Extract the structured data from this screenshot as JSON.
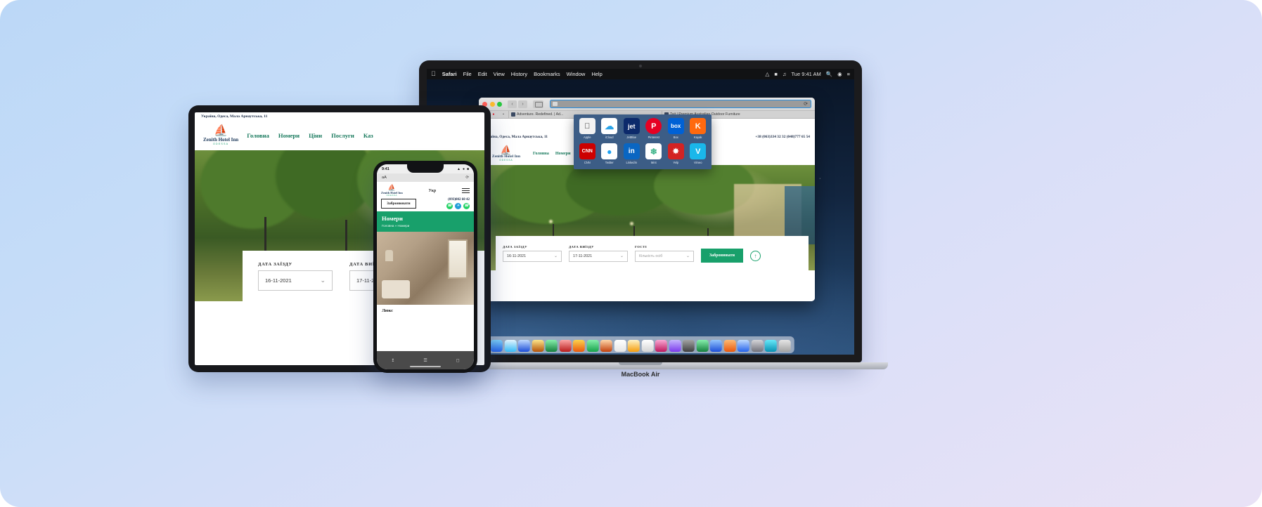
{
  "device_labels": {
    "macbook": "MacBook Air"
  },
  "macos": {
    "menubar": {
      "apple": "",
      "items": [
        "Safari",
        "File",
        "Edit",
        "View",
        "History",
        "Bookmarks",
        "Window",
        "Help"
      ],
      "status_icons": [
        "wifi-icon",
        "battery-icon",
        "volume-icon"
      ],
      "clock": "Tue 9:41 AM",
      "right_icons": [
        "search-icon",
        "siri-icon",
        "control-center-icon"
      ]
    },
    "dock": {
      "items": [
        "finder",
        "safari",
        "mail",
        "contacts",
        "calendar",
        "notes",
        "reminders",
        "maps",
        "photos",
        "messages",
        "facetime",
        "itunes",
        "ibooks",
        "app-store",
        "numbers",
        "keynote",
        "pages",
        "appstore2",
        "preferences",
        "divider",
        "screenshot",
        "trash"
      ]
    }
  },
  "safari": {
    "toolbar": {
      "traffic_lights": [
        "close",
        "minimize",
        "zoom"
      ],
      "back": "‹",
      "forward": "›",
      "sidebar_icon": "sidebar-icon",
      "address_value": "",
      "reload": "⟳"
    },
    "tabs": {
      "pinned": [
        "twitter-icon",
        "opera-icon",
        "pin-icon"
      ],
      "items": [
        {
          "title": "Adventure. Redefined. | Ad...",
          "active": false
        },
        {
          "title": "Tait | Premium Australian Outdoor Furniture",
          "active": false
        }
      ]
    },
    "favorites": {
      "row1": [
        {
          "label": "Apple",
          "icon": "apple-icon",
          "bg": "#f2f2f2",
          "fg": "#1b1b1b",
          "glyph": ""
        },
        {
          "label": "iCloud",
          "icon": "icloud-icon",
          "bg": "#ffffff",
          "fg": "#2aa3e8",
          "glyph": "☁"
        },
        {
          "label": "JetBlue",
          "icon": "jetblue-icon",
          "bg": "#0c2a6b",
          "fg": "#ffffff",
          "glyph": "jet"
        },
        {
          "label": "Pinterest",
          "icon": "pinterest-icon",
          "bg": "#e60023",
          "fg": "#ffffff",
          "glyph": "P"
        },
        {
          "label": "Box",
          "icon": "box-icon",
          "bg": "#0061d5",
          "fg": "#ffffff",
          "glyph": "box"
        },
        {
          "label": "Kayak",
          "icon": "kayak-icon",
          "bg": "#ff690f",
          "fg": "#ffffff",
          "glyph": "K"
        }
      ],
      "row2": [
        {
          "label": "CNN",
          "icon": "cnn-icon",
          "bg": "#cc0000",
          "fg": "#ffffff",
          "glyph": "CNN"
        },
        {
          "label": "Twitter",
          "icon": "twitter-icon",
          "bg": "#ffffff",
          "fg": "#1da1f2",
          "glyph": "🐦"
        },
        {
          "label": "LinkedIn",
          "icon": "linkedin-icon",
          "bg": "#0a66c2",
          "fg": "#ffffff",
          "glyph": "in"
        },
        {
          "label": "Mint",
          "icon": "mint-icon",
          "bg": "#ffffff",
          "fg": "#3eb489",
          "glyph": "🌿"
        },
        {
          "label": "Yelp",
          "icon": "yelp-icon",
          "bg": "#d32323",
          "fg": "#ffffff",
          "glyph": "⌘"
        },
        {
          "label": "Vimeo",
          "icon": "vimeo-icon",
          "bg": "#1ab7ea",
          "fg": "#ffffff",
          "glyph": "V"
        }
      ]
    }
  },
  "site": {
    "address": "Україна, Одеса, Мала Арнаутська, 11",
    "phones": "+38 (063)334 32 32   (048)777 65 54",
    "phone_mobile": "(093)002 60 42",
    "logo": {
      "name": "Zenith Hotel Inn",
      "sub": "ODESSA",
      "mark": "⛵"
    },
    "nav": [
      "Головна",
      "Номери",
      "Ціни",
      "Послуги",
      "Казино"
    ],
    "nav_tablet": [
      "Головна",
      "Номери",
      "Ціни",
      "Послуги",
      "Каз"
    ],
    "lang": "Укр",
    "book_button": "Забронювати",
    "booking": {
      "checkin_label": "ДАТА ЗАЇЗДУ",
      "checkin_value": "16-11-2021",
      "checkout_label": "ДАТА ВИЇЗДУ",
      "checkout_value": "17-11-2021",
      "guests_label": "ГОСТІ",
      "guests_placeholder": "Кількість осіб",
      "submit": "Забронювати",
      "chevron": "⌄",
      "info_icon": "info-icon"
    }
  },
  "phone": {
    "status": {
      "time": "9:41",
      "icons": "signal-wifi-battery"
    },
    "safari_bar": {
      "aa": "aA",
      "reload": "⟳"
    },
    "section_title": "Номери",
    "breadcrumb": "Головна  »  Номери",
    "room_caption": "Люкс",
    "social": [
      "whatsapp-icon",
      "telegram-icon",
      "viber-icon"
    ],
    "footer_icons": [
      "share-icon",
      "book-icon",
      "tabs-icon"
    ]
  }
}
